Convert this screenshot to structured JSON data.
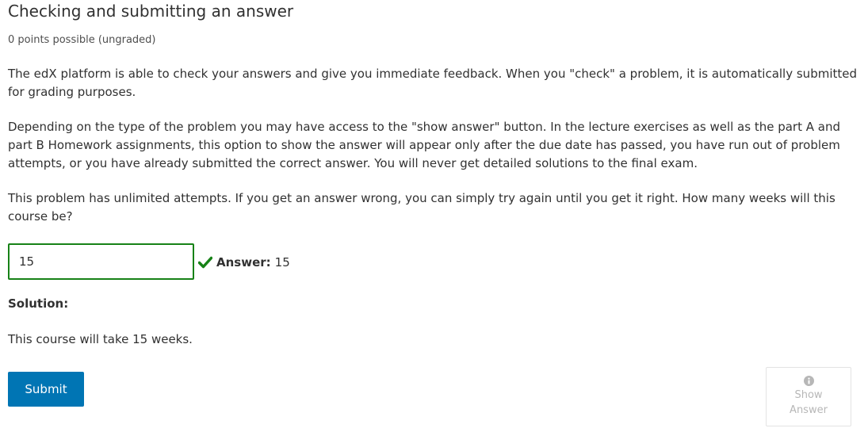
{
  "problem": {
    "title": "Checking and submitting an answer",
    "points": "0 points possible (ungraded)",
    "paragraphs": [
      "The edX platform is able to check your answers and give you immediate feedback. When you \"check\" a problem, it is automatically submitted for grading purposes.",
      "Depending on the type of the problem you may have access to the \"show answer\" button. In the lecture exercises as well as the part A and part B Homework assignments, this option to show the answer will appear only after the due date has passed, you have run out of problem attempts, or you have already submitted the correct answer. You will never get detailed solutions to the final exam.",
      "This problem has unlimited attempts. If you get an answer wrong, you can simply try again until you get it right. How many weeks will this course be?"
    ],
    "input_value": "15",
    "status": {
      "icon": "checkmark-icon",
      "label": "Answer:",
      "value": "15",
      "color": "#178217"
    },
    "solution": {
      "label": "Solution:",
      "text": "This course will take 15 weeks."
    },
    "actions": {
      "submit_label": "Submit",
      "show_answer_label": "Show Answer",
      "submit_color": "#0075b4"
    }
  }
}
